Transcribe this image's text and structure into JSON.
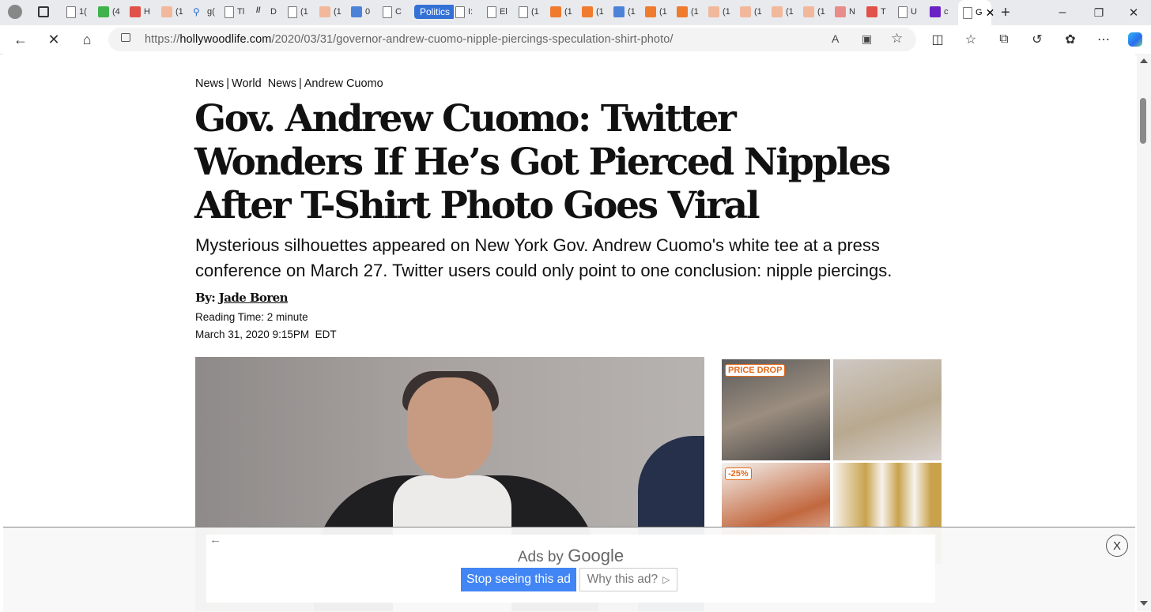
{
  "browser": {
    "tabs": [
      {
        "label": "1(",
        "icon": "doc"
      },
      {
        "label": "(4",
        "icon": "green"
      },
      {
        "label": "H",
        "icon": "red"
      },
      {
        "label": "(1",
        "icon": "peach"
      },
      {
        "label": "g(",
        "icon": "search"
      },
      {
        "label": "Tl",
        "icon": "doc"
      },
      {
        "label": "D",
        "icon": "dash"
      },
      {
        "label": "(1",
        "icon": "doc"
      },
      {
        "label": "(1",
        "icon": "peach"
      },
      {
        "label": "0",
        "icon": "blue"
      },
      {
        "label": "C",
        "icon": "doc"
      },
      {
        "label": "Politics",
        "icon": "pill"
      },
      {
        "label": "I:",
        "icon": "doc"
      },
      {
        "label": "El",
        "icon": "doc"
      },
      {
        "label": "(1",
        "icon": "doc"
      },
      {
        "label": "(1",
        "icon": "orange"
      },
      {
        "label": "(1",
        "icon": "orange"
      },
      {
        "label": "(1",
        "icon": "photo"
      },
      {
        "label": "(1",
        "icon": "orange"
      },
      {
        "label": "(1",
        "icon": "orange"
      },
      {
        "label": "(1",
        "icon": "peach"
      },
      {
        "label": "(1",
        "icon": "peach"
      },
      {
        "label": "(1",
        "icon": "peach"
      },
      {
        "label": "(1",
        "icon": "peach"
      },
      {
        "label": "N",
        "icon": "pink"
      },
      {
        "label": "T",
        "icon": "red"
      },
      {
        "label": "U",
        "icon": "doc"
      },
      {
        "label": "c",
        "icon": "purple"
      }
    ],
    "active_tab_label": "G",
    "url_prefix": "https://",
    "url_domain": "hollywoodlife.com",
    "url_path": "/2020/03/31/governor-andrew-cuomo-nipple-piercings-speculation-shirt-photo/"
  },
  "article": {
    "breadcrumb": [
      "News",
      "World  News",
      "Andrew Cuomo"
    ],
    "headline": "Gov. Andrew Cuomo: Twitter Wonders If He’s Got Pierced Nipples After T-Shirt Photo Goes Viral",
    "dek": "Mysterious silhouettes appeared on New York Gov. Andrew Cuomo's white tee at a press conference on March 27. Twitter users could only point to one conclusion: nipple piercings.",
    "byline_prefix": "By:",
    "author": "Jade Boren",
    "reading_time": "Reading Time: 2 minute",
    "date": "March 31, 2020 9:15PM  EDT"
  },
  "side_ad": {
    "tag_1": "PRICE DROP",
    "tag_2": "-25%"
  },
  "bottom_ad": {
    "ads_by": "Ads by",
    "google": "Google",
    "stop_button": "Stop seeing this ad",
    "why_button": "Why this ad?",
    "close": "X"
  }
}
